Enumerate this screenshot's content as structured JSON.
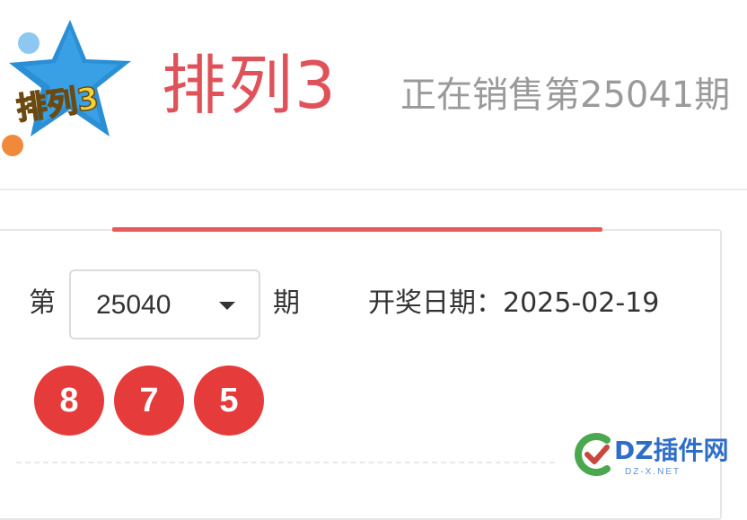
{
  "header": {
    "logo_text": "排列3",
    "title": "排列3",
    "sale_status": "正在销售第25041期"
  },
  "issue_selector": {
    "prefix": "第",
    "selected_issue": "25040",
    "suffix": "期"
  },
  "draw": {
    "date_text": "开奖日期：2025-02-19",
    "numbers": [
      "8",
      "7",
      "5"
    ]
  },
  "colors": {
    "accent": "#e0525a",
    "ball": "#e53b3b",
    "logo_star": "#2b8fd6",
    "watermark": "#2f6ec8"
  },
  "watermark": {
    "text": "DZ插件网",
    "sub": "DZ-X.NET"
  }
}
